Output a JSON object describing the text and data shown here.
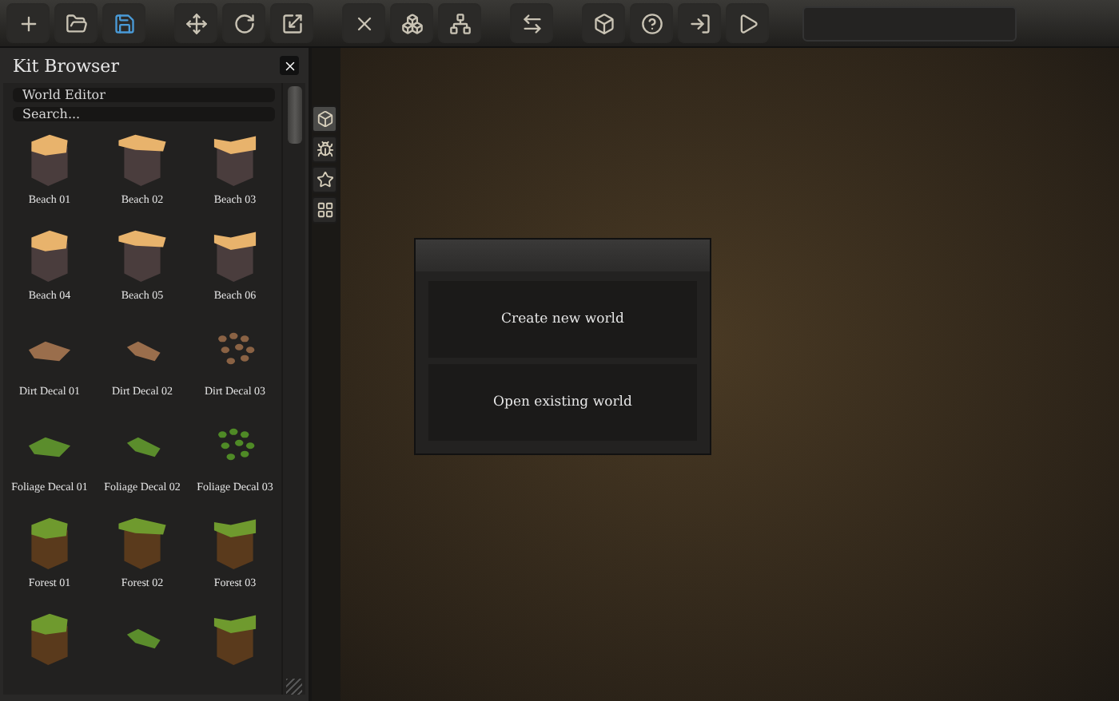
{
  "kit_browser": {
    "title": "Kit Browser",
    "kit_field": {
      "value": "World Editor"
    },
    "search": {
      "placeholder": "Search..."
    },
    "items": [
      {
        "label": "Beach 01",
        "kind": "beach"
      },
      {
        "label": "Beach 02",
        "kind": "beach"
      },
      {
        "label": "Beach 03",
        "kind": "beach"
      },
      {
        "label": "Beach 04",
        "kind": "beach"
      },
      {
        "label": "Beach 05",
        "kind": "beach"
      },
      {
        "label": "Beach 06",
        "kind": "beach"
      },
      {
        "label": "Dirt Decal 01",
        "kind": "dirt"
      },
      {
        "label": "Dirt Decal 02",
        "kind": "dirt"
      },
      {
        "label": "Dirt Decal 03",
        "kind": "dirt-scatter"
      },
      {
        "label": "Foliage Decal 01",
        "kind": "foliage"
      },
      {
        "label": "Foliage Decal 02",
        "kind": "foliage"
      },
      {
        "label": "Foliage Decal 03",
        "kind": "foliage-scatter"
      },
      {
        "label": "Forest 01",
        "kind": "forest"
      },
      {
        "label": "Forest 02",
        "kind": "forest"
      },
      {
        "label": "Forest 03",
        "kind": "forest"
      },
      {
        "kind": "forest"
      },
      {
        "kind": "foliage"
      },
      {
        "kind": "forest"
      }
    ]
  },
  "side_tabs": [
    {
      "selected": true
    },
    {
      "selected": false
    },
    {
      "selected": false
    },
    {
      "selected": false
    }
  ],
  "dialog": {
    "buttons": [
      "Create new world",
      "Open existing world"
    ]
  }
}
